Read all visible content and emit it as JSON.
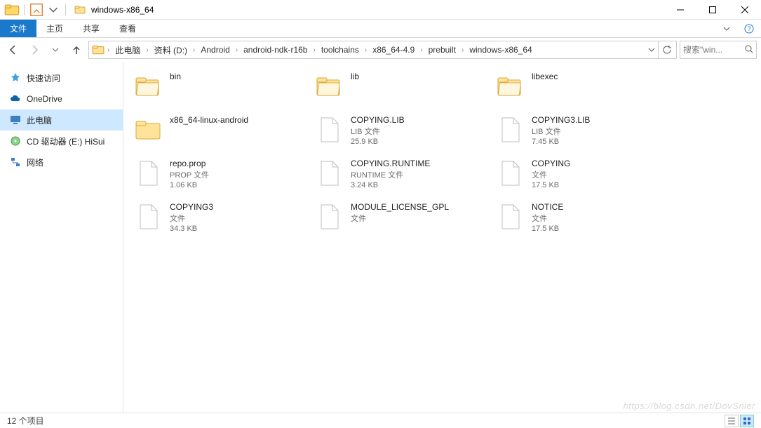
{
  "window": {
    "title": "windows-x86_64"
  },
  "ribbon": {
    "file": "文件",
    "tabs": [
      "主页",
      "共享",
      "查看"
    ]
  },
  "breadcrumb": {
    "items": [
      "此电脑",
      "资料 (D:)",
      "Android",
      "android-ndk-r16b",
      "toolchains",
      "x86_64-4.9",
      "prebuilt",
      "windows-x86_64"
    ]
  },
  "search": {
    "placeholder": "搜索\"win..."
  },
  "sidebar": {
    "items": [
      {
        "label": "快速访问",
        "icon": "star",
        "color": "#2a90d8"
      },
      {
        "label": "OneDrive",
        "icon": "cloud",
        "color": "#0a64a4"
      },
      {
        "label": "此电脑",
        "icon": "monitor",
        "color": "#2a72b5",
        "selected": true
      },
      {
        "label": "CD 驱动器 (E:) HiSui",
        "icon": "disc",
        "color": "#5aae4a"
      },
      {
        "label": "网络",
        "icon": "network",
        "color": "#2a72b5"
      }
    ]
  },
  "files": {
    "col1": [
      {
        "name": "bin",
        "kind": "folder-open"
      },
      {
        "name": "x86_64-linux-android",
        "kind": "folder"
      },
      {
        "name": "repo.prop",
        "type": "PROP 文件",
        "size": "1.06 KB",
        "kind": "file"
      },
      {
        "name": "COPYING3",
        "type": "文件",
        "size": "34.3 KB",
        "kind": "file"
      }
    ],
    "col2": [
      {
        "name": "lib",
        "kind": "folder-open"
      },
      {
        "name": "COPYING.LIB",
        "type": "LIB 文件",
        "size": "25.9 KB",
        "kind": "file"
      },
      {
        "name": "COPYING.RUNTIME",
        "type": "RUNTIME 文件",
        "size": "3.24 KB",
        "kind": "file"
      },
      {
        "name": "MODULE_LICENSE_GPL",
        "type": "文件",
        "size": "",
        "kind": "file",
        "wrap": true
      }
    ],
    "col3": [
      {
        "name": "libexec",
        "kind": "folder-open"
      },
      {
        "name": "COPYING3.LIB",
        "type": "LIB 文件",
        "size": "7.45 KB",
        "kind": "file"
      },
      {
        "name": "COPYING",
        "type": "文件",
        "size": "17.5 KB",
        "kind": "file"
      },
      {
        "name": "NOTICE",
        "type": "文件",
        "size": "17.5 KB",
        "kind": "file"
      }
    ]
  },
  "status": {
    "count_label": "12 个项目"
  },
  "watermark": "https://blog.csdn.net/DovSnier"
}
